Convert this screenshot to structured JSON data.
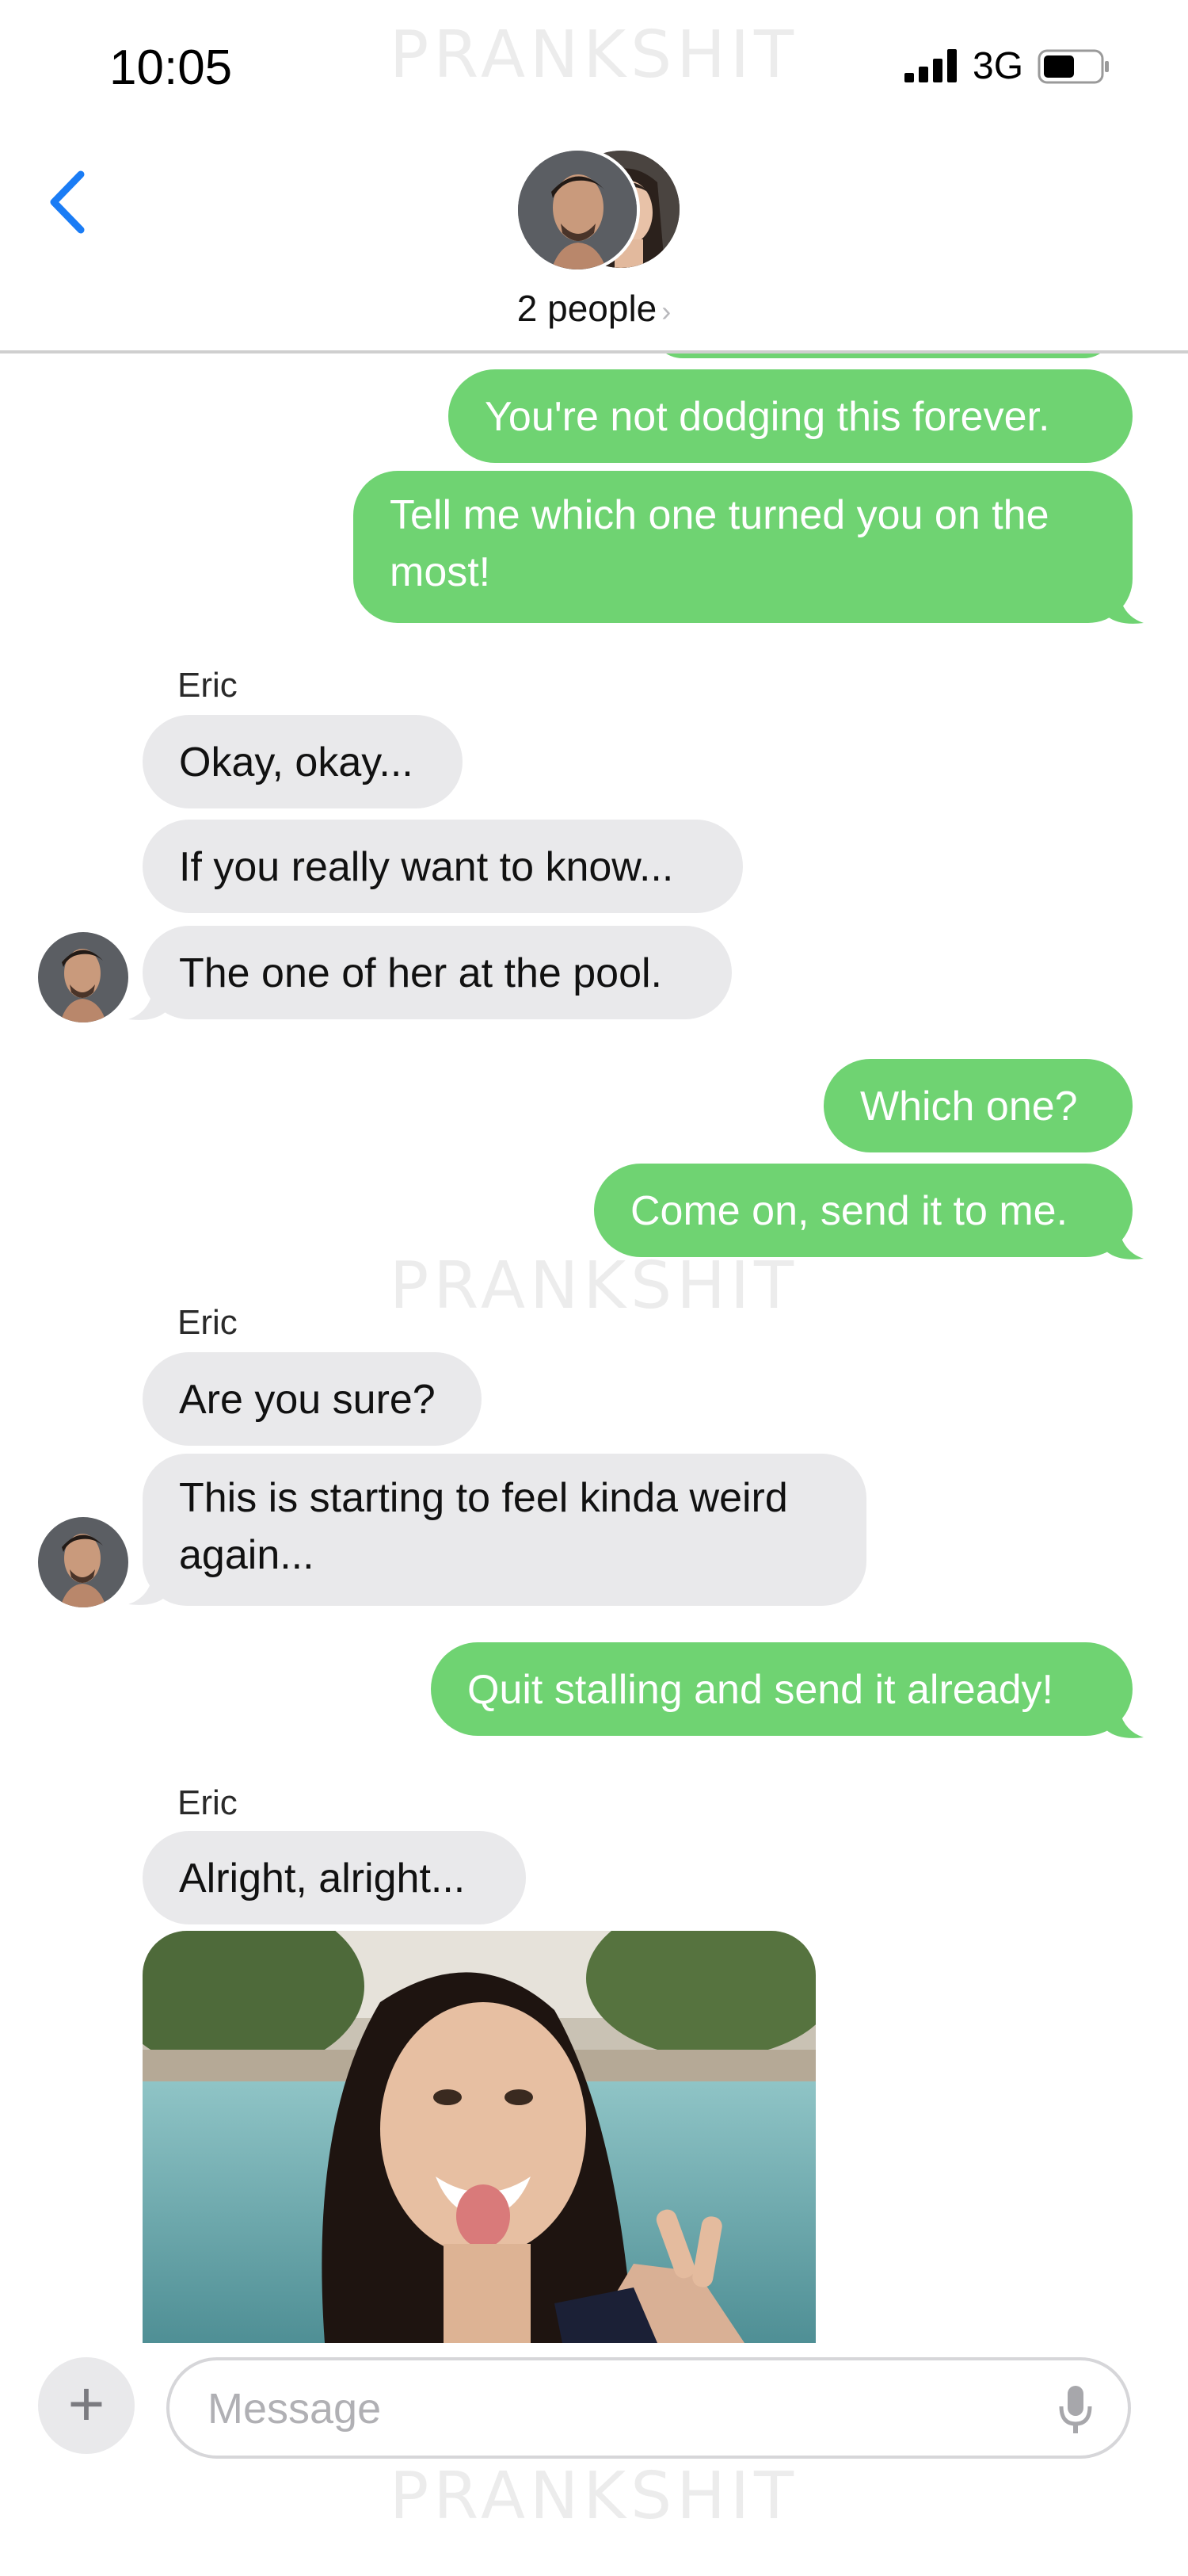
{
  "status_bar": {
    "time": "10:05",
    "network": "3G"
  },
  "header": {
    "title": "2 people",
    "chevron": "›"
  },
  "watermark": "PRANKSHIT",
  "messages": [
    {
      "side": "out",
      "text": "You're not dodging this forever."
    },
    {
      "side": "out",
      "text_line1": "Tell me which one turned you on the",
      "text_line2": "most!"
    },
    {
      "side": "in",
      "sender": "Eric",
      "text": "Okay, okay..."
    },
    {
      "side": "in",
      "text": "If you really want to know..."
    },
    {
      "side": "in",
      "text": "The one of her at the pool."
    },
    {
      "side": "out",
      "text": "Which one?"
    },
    {
      "side": "out",
      "text": "Come on, send it to me."
    },
    {
      "side": "in",
      "sender": "Eric",
      "text": "Are you sure?"
    },
    {
      "side": "in",
      "text_line1": "This is starting to feel kinda weird",
      "text_line2": "again..."
    },
    {
      "side": "out",
      "text": "Quit stalling and send it already!"
    },
    {
      "side": "in",
      "sender": "Eric",
      "text": "Alright, alright..."
    },
    {
      "side": "in",
      "type": "photo"
    }
  ],
  "composer": {
    "placeholder": "Message"
  },
  "colors": {
    "outgoing": "#6fd372",
    "incoming": "#e9e9eb",
    "accent": "#1a7cf5"
  },
  "icons": [
    "back-chevron-icon",
    "plus-icon",
    "microphone-icon",
    "signal-bars-icon",
    "battery-icon"
  ]
}
